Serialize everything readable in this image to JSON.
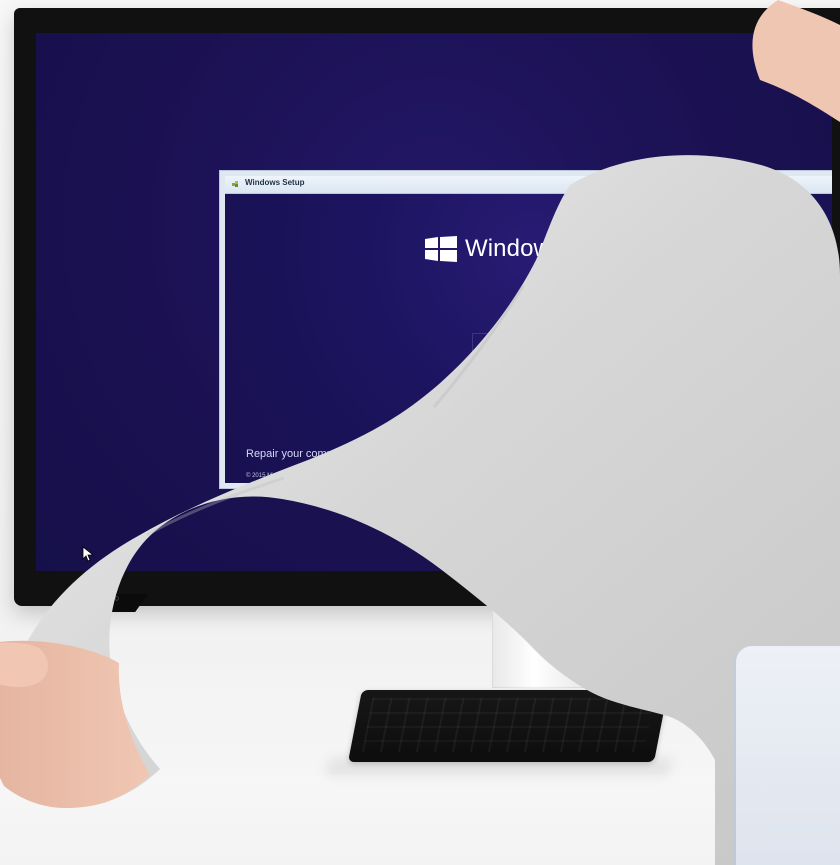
{
  "window": {
    "title": "Windows Setup",
    "brand_text": "Windows",
    "repair_link": "Repair your computer",
    "copyright": "© 2015 Microsoft Corporation. Al"
  },
  "icons": {
    "setup_icon": "setup-icon",
    "windows_logo": "windows-logo-icon",
    "cursor": "mouse-cursor-icon",
    "power": "power-icon"
  },
  "colors": {
    "screen_background": "#1b1152",
    "window_frame": "#dfe7f0",
    "brand_text": "#ffffff"
  }
}
